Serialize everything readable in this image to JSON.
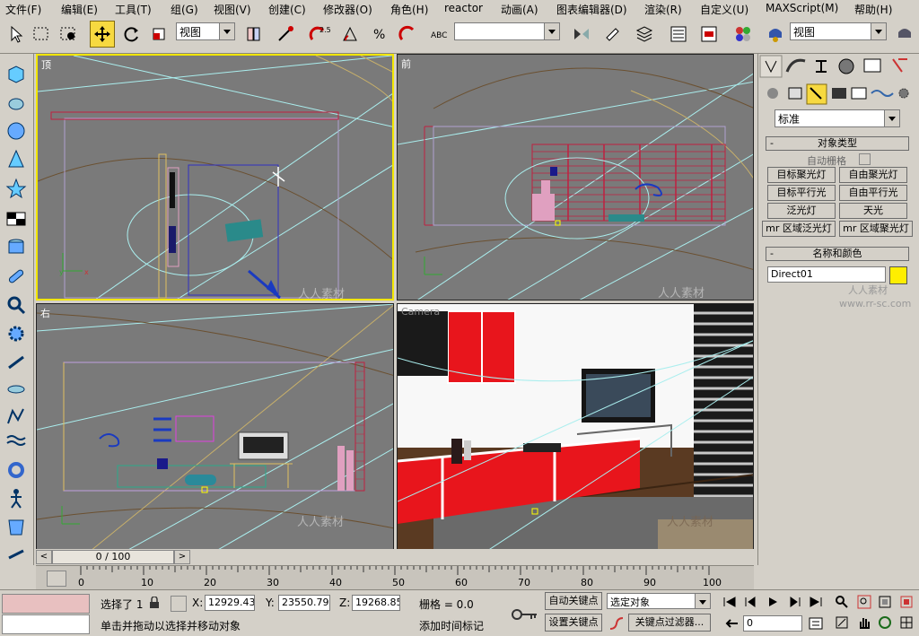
{
  "menu": [
    "文件(F)",
    "编辑(E)",
    "工具(T)",
    "组(G)",
    "视图(V)",
    "创建(C)",
    "修改器(O)",
    "角色(H)",
    "reactor",
    "动画(A)",
    "图表编辑器(D)",
    "渲染(R)",
    "自定义(U)",
    "MAXScript(M)",
    "帮助(H)"
  ],
  "toolbar": {
    "ref_coord": "视图",
    "selection_set": "视图",
    "spinner_snap_value": "2.5"
  },
  "viewports": {
    "top": {
      "label": "顶"
    },
    "front": {
      "label": "前"
    },
    "right": {
      "label": "右"
    },
    "camera": {
      "label": "Camera"
    }
  },
  "command_panel": {
    "category": "标准",
    "object_type_title": "对象类型",
    "autogrid": "自动栅格",
    "buttons": [
      "目标聚光灯",
      "自由聚光灯",
      "目标平行光",
      "自由平行光",
      "泛光灯",
      "天光",
      "mr 区域泛光灯",
      "mr 区域聚光灯"
    ],
    "name_color_title": "名称和颜色",
    "object_name": "Direct01",
    "object_color": "#ffee00"
  },
  "timeline": {
    "frame": "0 / 100",
    "ticks": [
      "0",
      "10",
      "20",
      "30",
      "40",
      "50",
      "60",
      "70",
      "80",
      "90",
      "100"
    ]
  },
  "status": {
    "selection": "选择了 1",
    "x_label": "X:",
    "x": "12929.43",
    "y_label": "Y:",
    "y": "23550.797",
    "z_label": "Z:",
    "z": "19268.85",
    "grid": "栅格 = 0.0",
    "prompt": "单击并拖动以选择并移动对象",
    "add_time_tag": "添加时间标记",
    "auto_key": "自动关键点",
    "set_key": "设置关键点",
    "key_mode": "选定对象",
    "key_filters": "关键点过滤器...",
    "current_frame": "0"
  },
  "watermarks": {
    "brand": "人人素材",
    "url": "www.rr-sc.com"
  }
}
